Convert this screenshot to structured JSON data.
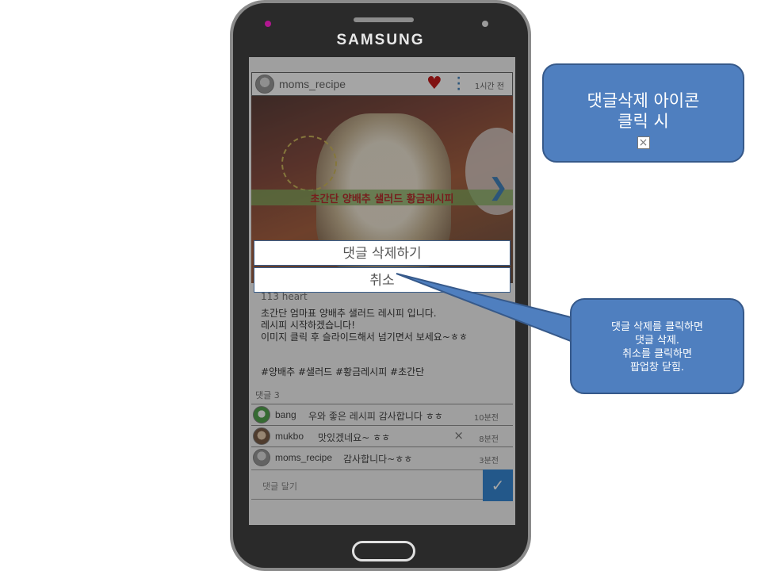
{
  "phone": {
    "brand": "SAMSUNG"
  },
  "post": {
    "username": "moms_recipe",
    "time": "1시간 전",
    "image_caption": "초간단 양배추 샐러드 황금레시피",
    "likes_label": "113  heart",
    "text_lines": [
      "초간단 엄마표 양배추 샐러드 레시피 입니다.",
      "레시피 시작하겠습니다!",
      "이미지 클릭 후 슬라이드해서 넘기면서 보세요~ㅎㅎ"
    ],
    "hashtags": "#양배추 #샐러드 #황금레시피 #초간단",
    "comment_count_label": "댓글 3"
  },
  "comments": [
    {
      "user": "bang",
      "text": "우와 좋은 레시피 감사합니다 ㅎㅎ",
      "time": "10분전"
    },
    {
      "user": "mukbo",
      "text": "맛있겠네요~ ㅎㅎ",
      "time": "8분전",
      "delete_icon": "×"
    },
    {
      "user": "moms_recipe",
      "text": "감사합니다~ㅎㅎ",
      "time": "3분전"
    }
  ],
  "comment_input": {
    "placeholder": "댓글 달기",
    "send_icon": "✓"
  },
  "popup": {
    "delete_label": "댓글 삭제하기",
    "cancel_label": "취소"
  },
  "annotations": {
    "top_line1": "댓글삭제 아이콘",
    "top_line2": "클릭 시",
    "top_icon": "×",
    "right_lines": [
      "댓글 삭제를 클릭하면",
      "댓글 삭제.",
      "취소를 클릭하면",
      "팝업창 닫힘."
    ]
  },
  "colors": {
    "accent": "#4f7fbf",
    "send": "#1f7ad1",
    "heart": "#c00000",
    "caption": "#b01818"
  }
}
